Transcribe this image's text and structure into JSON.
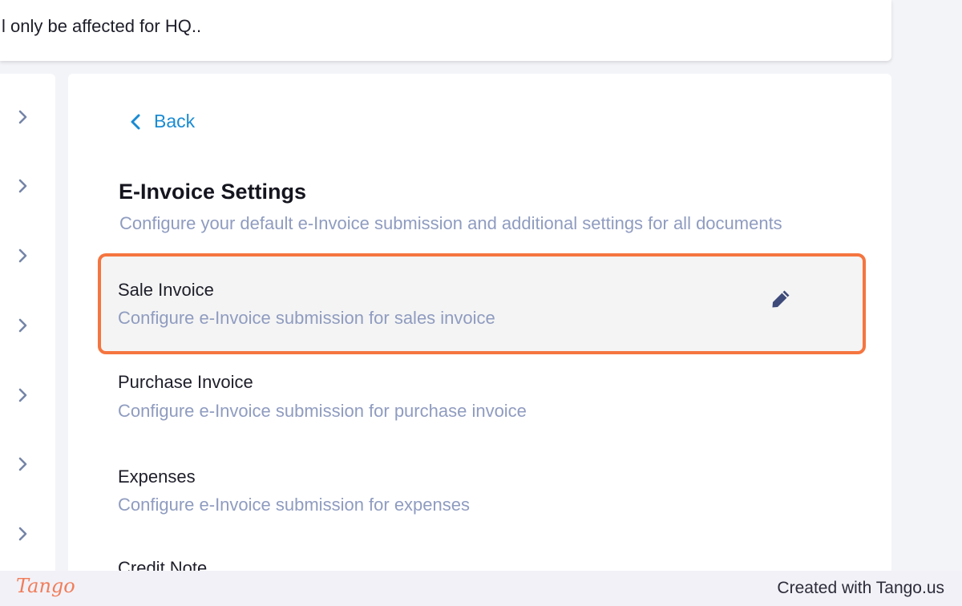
{
  "banner": {
    "text": "l only be affected for HQ.."
  },
  "rail": {
    "chevron_icon": "chevron-right-icon",
    "count": 7
  },
  "panel": {
    "back_label": "Back",
    "back_icon": "chevron-left-icon",
    "title": "E-Invoice Settings",
    "subtitle": "Configure your default e-Invoice submission and additional settings for all documents",
    "items": [
      {
        "name": "Sale Invoice",
        "desc": "Configure e-Invoice submission for sales invoice",
        "icon": "pencil-icon"
      },
      {
        "name": "Purchase Invoice",
        "desc": "Configure e-Invoice submission for purchase invoice"
      },
      {
        "name": "Expenses",
        "desc": "Configure e-Invoice submission for expenses"
      },
      {
        "name": "Credit Note"
      }
    ]
  },
  "footer": {
    "brand": "Tango",
    "credit": "Created with Tango.us"
  },
  "colors": {
    "accent": "#1a8bd3",
    "highlight_border": "#f5753f",
    "edit_icon": "#3d4a7a",
    "muted_text": "#8f9cc0"
  }
}
